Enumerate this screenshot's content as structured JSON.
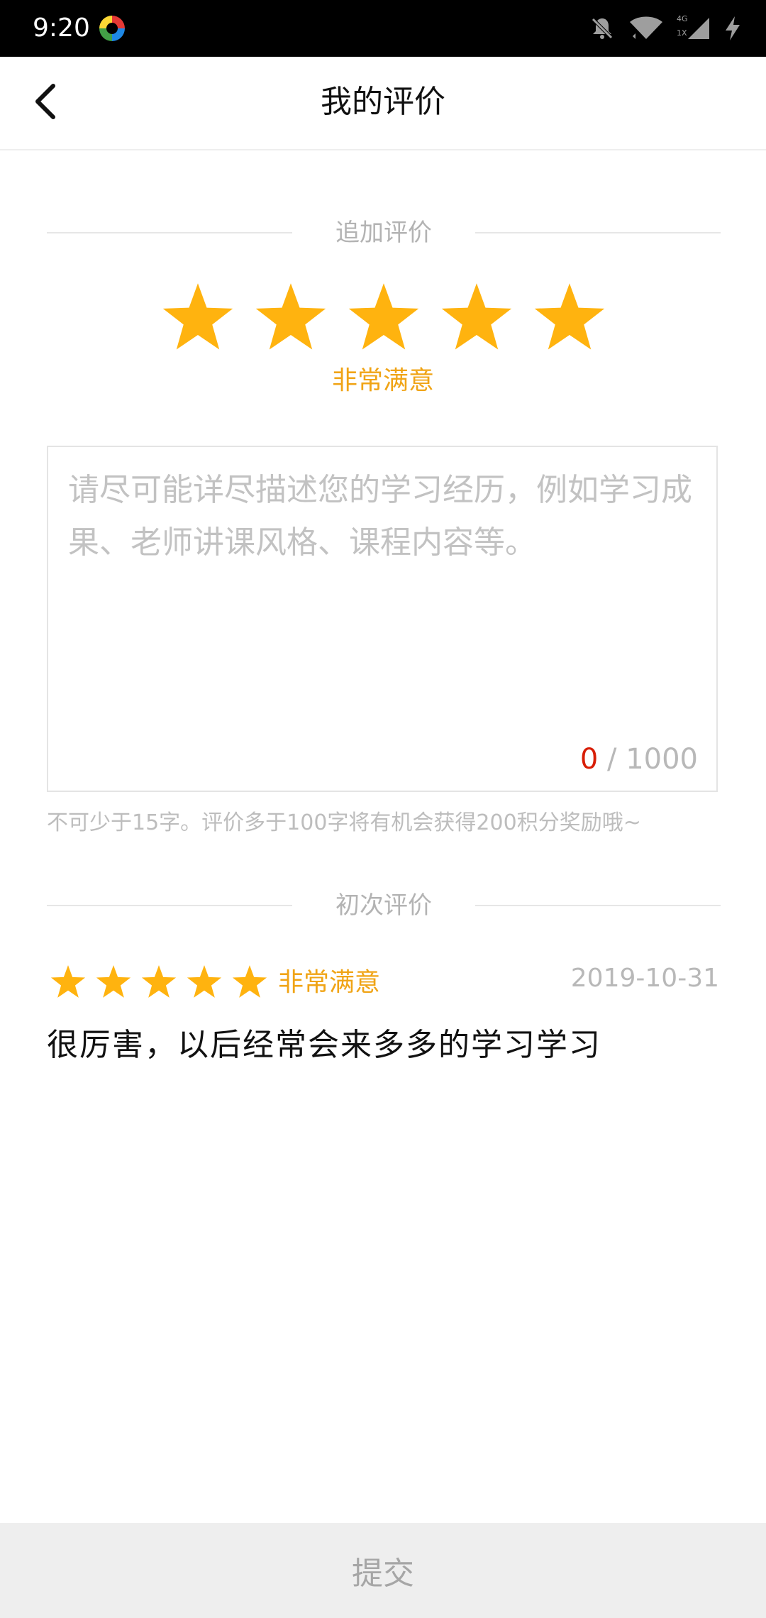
{
  "status_bar": {
    "time": "9:20",
    "icons": [
      "app-logo-icon",
      "mute-bell-icon",
      "wifi-icon",
      "cellular-4g-icon",
      "charging-bolt-icon"
    ],
    "network_label_top": "4G",
    "network_label_bottom": "1X"
  },
  "header": {
    "title": "我的评价",
    "back_icon": "chevron-left-icon"
  },
  "additional_review": {
    "section_label": "追加评价",
    "rating": 5,
    "rating_max": 5,
    "rating_label": "非常满意",
    "input_value": "",
    "input_placeholder": "请尽可能详尽描述您的学习经历，例如学习成果、老师讲课风格、课程内容等。",
    "char_count": "0",
    "char_separator": " / ",
    "char_limit": "1000",
    "hint": "不可少于15字。评价多于100字将有机会获得200积分奖励哦~"
  },
  "initial_review": {
    "section_label": "初次评价",
    "rating": 5,
    "rating_max": 5,
    "rating_label": "非常满意",
    "date": "2019-10-31",
    "comment": "很厉害，以后经常会来多多的学习学习"
  },
  "submit": {
    "label": "提交"
  },
  "colors": {
    "star": "#ffb30f",
    "rating_text": "#f0a416",
    "counter_current": "#d81e06",
    "divider": "#e6e6e6",
    "submit_bg": "#eeeeee"
  }
}
